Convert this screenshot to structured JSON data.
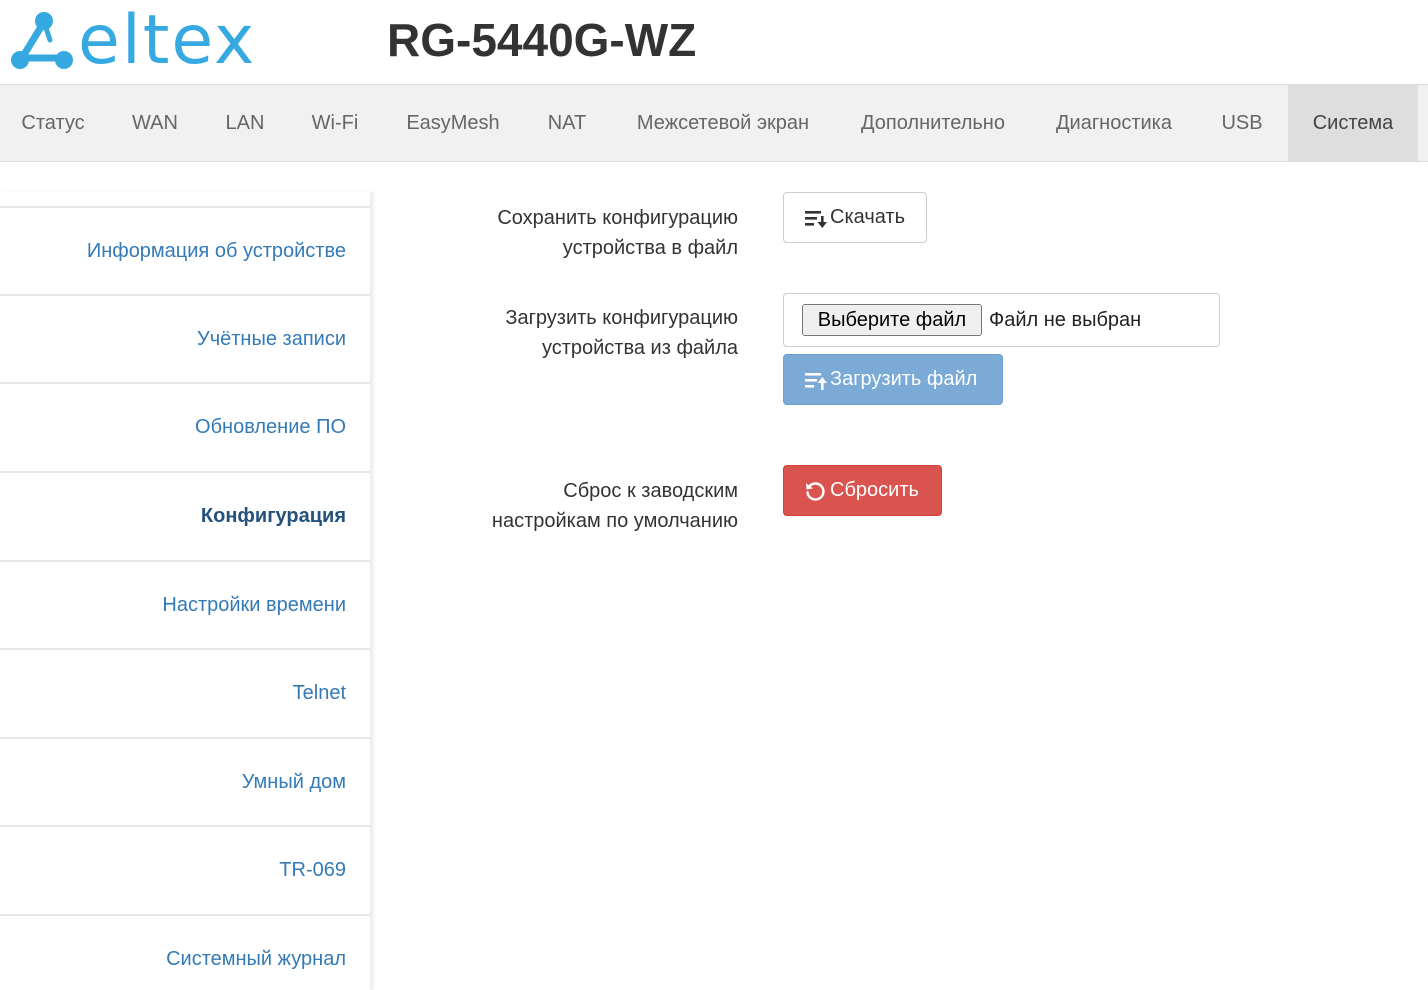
{
  "header": {
    "logo_text": "eltex",
    "model": "RG-5440G-WZ"
  },
  "nav": {
    "items": [
      {
        "label": "Статус"
      },
      {
        "label": "WAN"
      },
      {
        "label": "LAN"
      },
      {
        "label": "Wi-Fi"
      },
      {
        "label": "EasyMesh"
      },
      {
        "label": "NAT"
      },
      {
        "label": "Межсетевой экран"
      },
      {
        "label": "Дополнительно"
      },
      {
        "label": "Диагностика"
      },
      {
        "label": "USB"
      },
      {
        "label": "Система"
      }
    ],
    "active": "Система"
  },
  "sidebar": {
    "items": [
      {
        "label": "Информация об устройстве"
      },
      {
        "label": "Учётные записи"
      },
      {
        "label": "Обновление ПО"
      },
      {
        "label": "Конфигурация"
      },
      {
        "label": "Настройки времени"
      },
      {
        "label": "Telnet"
      },
      {
        "label": "Умный дом"
      },
      {
        "label": "TR-069"
      },
      {
        "label": "Системный журнал"
      }
    ],
    "active": "Конфигурация"
  },
  "config": {
    "save_label_line1": "Сохранить конфигурацию",
    "save_label_line2": "устройства в файл",
    "download_button": "Скачать",
    "upload_label_line1": "Загрузить конфигурацию",
    "upload_label_line2": "устройства из файла",
    "choose_file_button": "Выберите файл",
    "file_status": "Файл не выбран",
    "upload_button": "Загрузить файл",
    "reset_label_line1": "Сброс к заводским",
    "reset_label_line2": "настройкам по умолчанию",
    "reset_button": "Сбросить"
  },
  "colors": {
    "brand": "#36a9e1",
    "link": "#337ab7",
    "danger": "#d9534f",
    "primary_disabled": "#7aaad5"
  }
}
